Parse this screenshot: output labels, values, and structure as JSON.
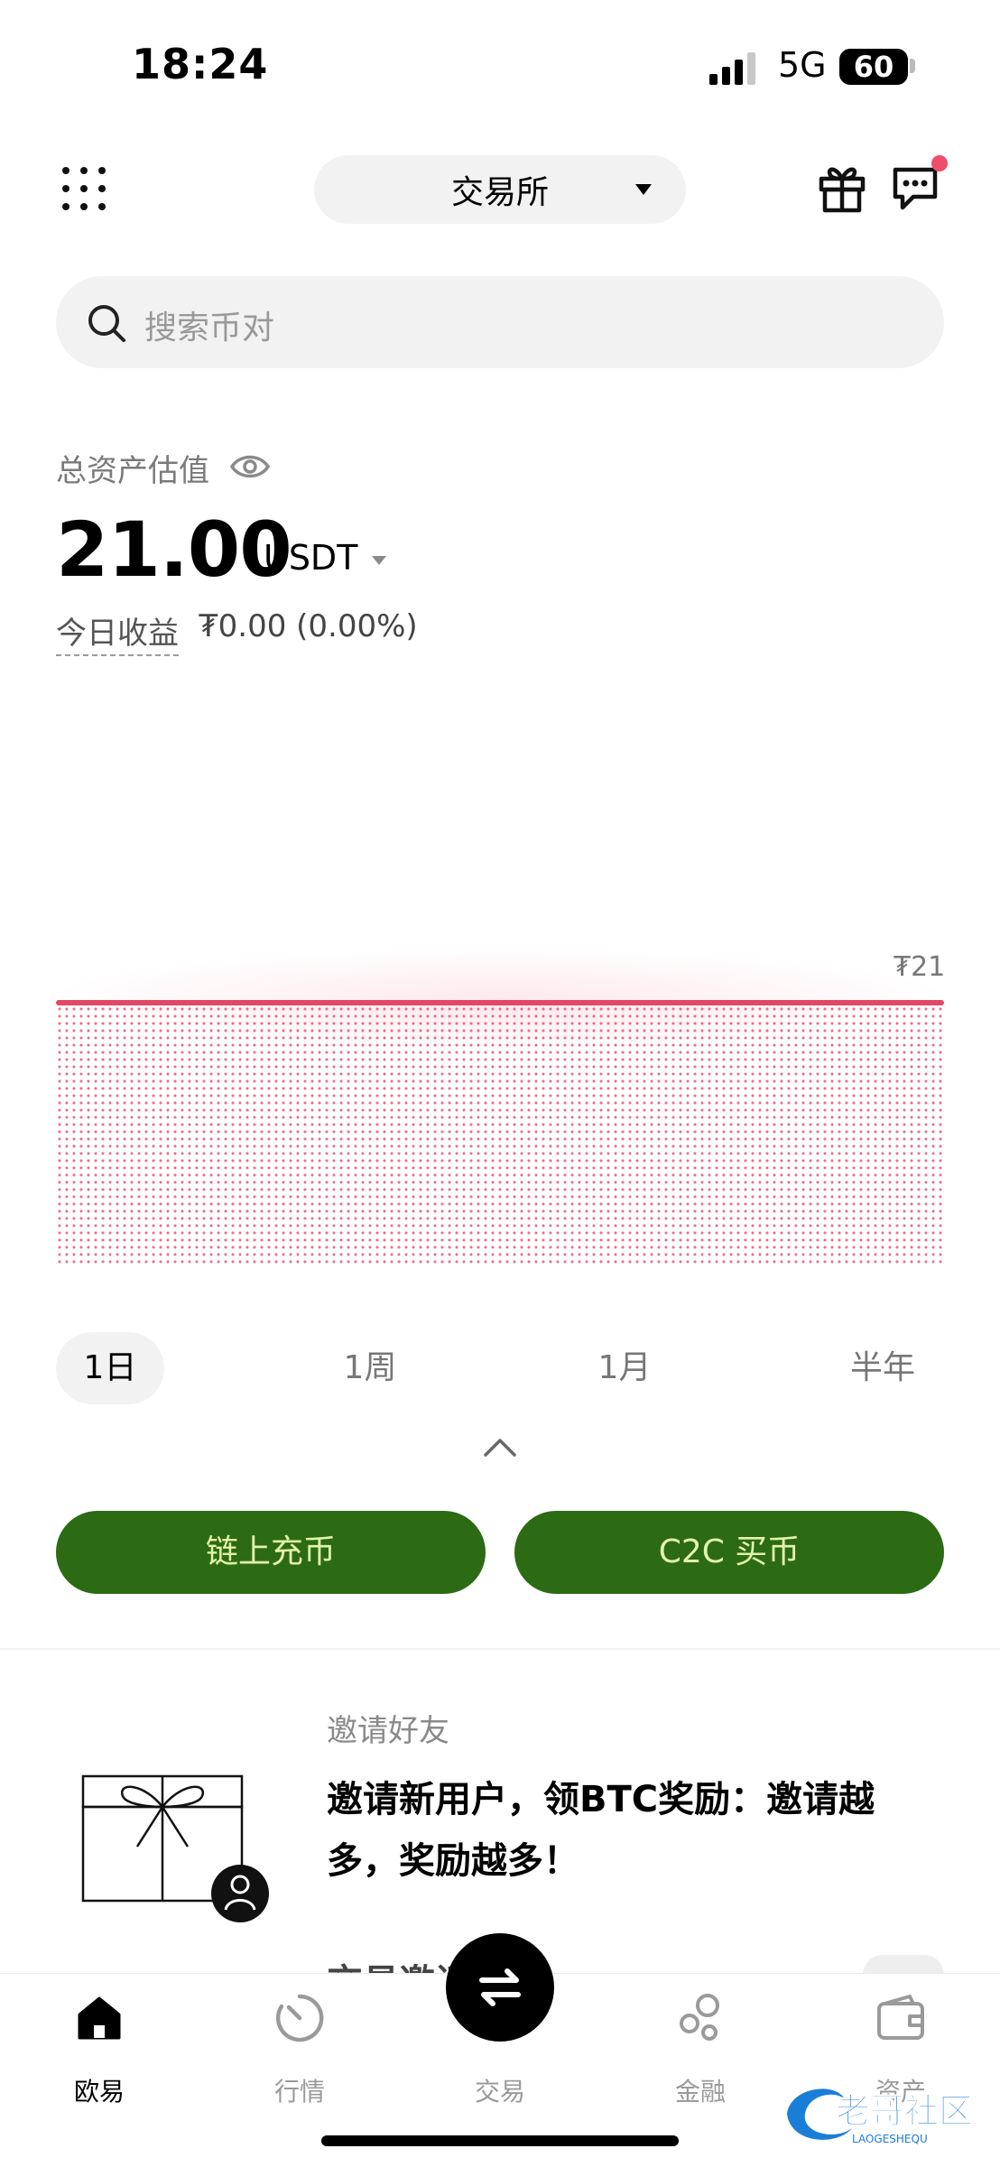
{
  "status_bar": {
    "time": "18:24",
    "network": "5G",
    "battery": "60"
  },
  "header": {
    "exchange_selector": "交易所",
    "icons": [
      "menu-grid-icon",
      "gift-icon",
      "chat-icon"
    ],
    "notification_dot_color": "#ee4d6b"
  },
  "search": {
    "placeholder": "搜索币对"
  },
  "assets": {
    "label": "总资产估值",
    "value": "21.00",
    "currency": "USDT",
    "pnl_label": "今日收益",
    "pnl_value": "₮0.00 (0.00%)"
  },
  "chart_data": {
    "type": "area",
    "series": [
      {
        "values": [
          21,
          21
        ]
      }
    ],
    "last_value_label": "₮21",
    "line_color": "#e04866",
    "grid": false
  },
  "periods": {
    "active": "1日",
    "tabs": [
      "1日",
      "1周",
      "1月",
      "半年"
    ]
  },
  "actions": {
    "deposit": "链上充币",
    "c2c": "C2C 买币",
    "button_color": "#2c6b14",
    "button_text_color": "#e3f5a8"
  },
  "invite": {
    "kicker": "邀请好友",
    "headline": "邀请新用户，领BTC奖励：邀请越多，奖励越多！",
    "next_teaser": "交易邀请"
  },
  "bottom_nav": {
    "items": [
      {
        "label": "欧易",
        "icon": "home-icon",
        "active": true
      },
      {
        "label": "行情",
        "icon": "markets-icon",
        "active": false
      },
      {
        "label": "交易",
        "icon": "swap-arrows-icon",
        "active": false
      },
      {
        "label": "金融",
        "icon": "finance-circles-icon",
        "active": false
      },
      {
        "label": "资产",
        "icon": "wallet-icon",
        "active": false
      }
    ]
  },
  "watermark": {
    "text": "老哥社区",
    "subtext": "LAOGESHEQU"
  }
}
